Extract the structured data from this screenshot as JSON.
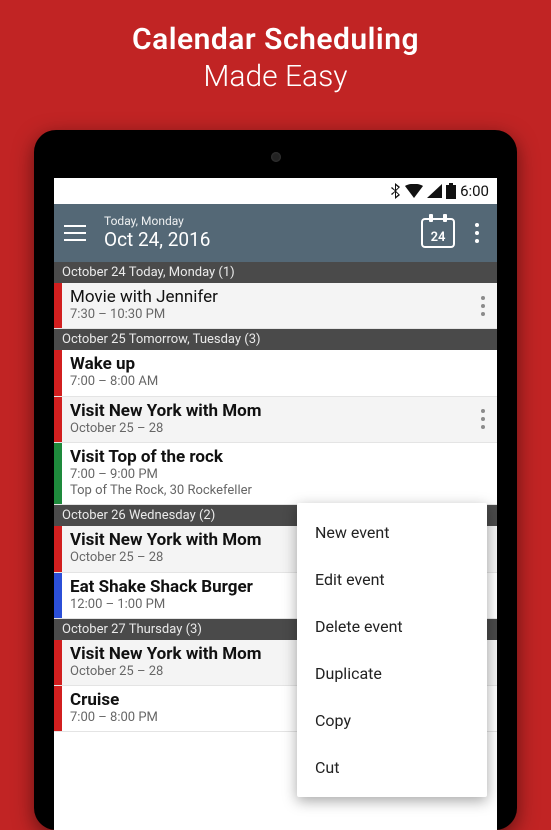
{
  "promo": {
    "line1": "Calendar Scheduling",
    "line2": "Made Easy"
  },
  "status": {
    "time": "6:00"
  },
  "appbar": {
    "subtitle": "Today, Monday",
    "title": "Oct 24, 2016",
    "day_badge": "24"
  },
  "colors": {
    "red": "#d21f1f",
    "green": "#1e8a3c",
    "blue": "#2b4fd8"
  },
  "sections": [
    {
      "header": "October 24 Today, Monday (1)",
      "events": [
        {
          "color": "red",
          "title": "Movie with Jennifer",
          "bold": false,
          "sub1": "7:30 – 10:30 PM",
          "sub2": "",
          "menu": true,
          "alt": true
        }
      ]
    },
    {
      "header": "October 25 Tomorrow, Tuesday (3)",
      "events": [
        {
          "color": "red",
          "title": "Wake up",
          "bold": true,
          "sub1": "7:00 – 8:00 AM",
          "sub2": "",
          "menu": false,
          "alt": false
        },
        {
          "color": "red",
          "title": "Visit New York with Mom",
          "bold": true,
          "sub1": "October 25 – 28",
          "sub2": "",
          "menu": true,
          "alt": true
        },
        {
          "color": "green",
          "title": "Visit Top of the rock",
          "bold": true,
          "sub1": "7:00 – 9:00 PM",
          "sub2": "Top of The Rock, 30 Rockefeller",
          "menu": false,
          "alt": false
        }
      ]
    },
    {
      "header": "October 26 Wednesday (2)",
      "events": [
        {
          "color": "red",
          "title": "Visit New York with Mom",
          "bold": true,
          "sub1": "October 25 – 28",
          "sub2": "",
          "menu": false,
          "alt": true
        },
        {
          "color": "blue",
          "title": "Eat Shake Shack Burger",
          "bold": true,
          "sub1": "12:00 – 1:00 PM",
          "sub2": "",
          "menu": false,
          "alt": false
        }
      ]
    },
    {
      "header": "October 27 Thursday (3)",
      "events": [
        {
          "color": "red",
          "title": "Visit New York with Mom",
          "bold": true,
          "sub1": "October 25 – 28",
          "sub2": "",
          "menu": false,
          "alt": true
        },
        {
          "color": "red",
          "title": "Cruise",
          "bold": true,
          "sub1": "7:00 – 8:00 PM",
          "sub2": "",
          "menu": false,
          "alt": false
        }
      ]
    }
  ],
  "context_menu": [
    "New event",
    "Edit event",
    "Delete event",
    "Duplicate",
    "Copy",
    "Cut"
  ]
}
